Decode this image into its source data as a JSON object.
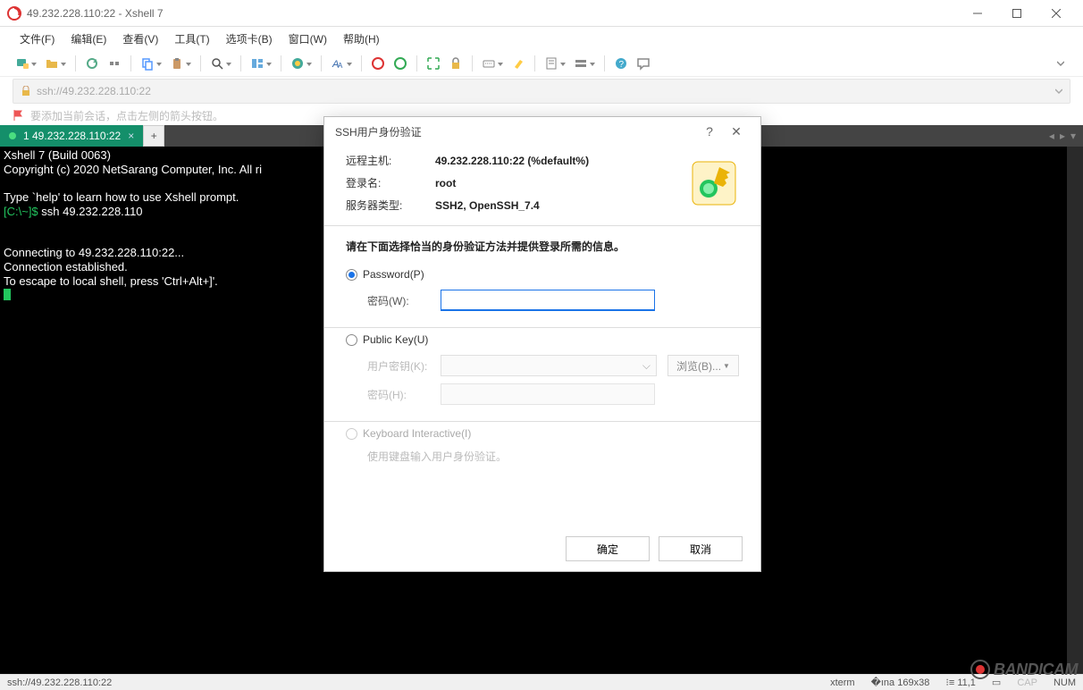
{
  "titlebar": {
    "text": "49.232.228.110:22 - Xshell 7"
  },
  "menu": {
    "file": "文件(F)",
    "edit": "编辑(E)",
    "view": "查看(V)",
    "tools": "工具(T)",
    "tabs": "选项卡(B)",
    "window": "窗口(W)",
    "help": "帮助(H)"
  },
  "address": {
    "text": "ssh://49.232.228.110:22"
  },
  "hint": {
    "text": "要添加当前会话，点击左侧的箭头按钮。"
  },
  "tabs": {
    "active": "1 49.232.228.110:22"
  },
  "terminal": {
    "l1": "Xshell 7 (Build 0063)",
    "l2": "Copyright (c) 2020 NetSarang Computer, Inc. All ri",
    "l3": "Type `help' to learn how to use Xshell prompt.",
    "prompt": "[C:\\~]$ ",
    "cmd": "ssh 49.232.228.110",
    "l5": "Connecting to 49.232.228.110:22...",
    "l6": "Connection established.",
    "l7": "To escape to local shell, press 'Ctrl+Alt+]'."
  },
  "dialog": {
    "title": "SSH用户身份验证",
    "host_lbl": "远程主机:",
    "host_val": "49.232.228.110:22 (%default%)",
    "user_lbl": "登录名:",
    "user_val": "root",
    "type_lbl": "服务器类型:",
    "type_val": "SSH2, OpenSSH_7.4",
    "instruction": "请在下面选择恰当的身份验证方法并提供登录所需的信息。",
    "password_radio": "Password(P)",
    "password_lbl": "密码(W):",
    "pubkey_radio": "Public Key(U)",
    "userkey_lbl": "用户密钥(K):",
    "browse_btn": "浏览(B)...",
    "pk_pass_lbl": "密码(H):",
    "kbd_radio": "Keyboard Interactive(I)",
    "kbd_hint": "使用键盘输入用户身份验证。",
    "ok": "确定",
    "cancel": "取消"
  },
  "status": {
    "left": "ssh://49.232.228.110:22",
    "term": "xterm",
    "size": "169x38",
    "pos": "11,1",
    "cap": "CAP",
    "num": "NUM"
  },
  "watermark": "BANDICAM"
}
